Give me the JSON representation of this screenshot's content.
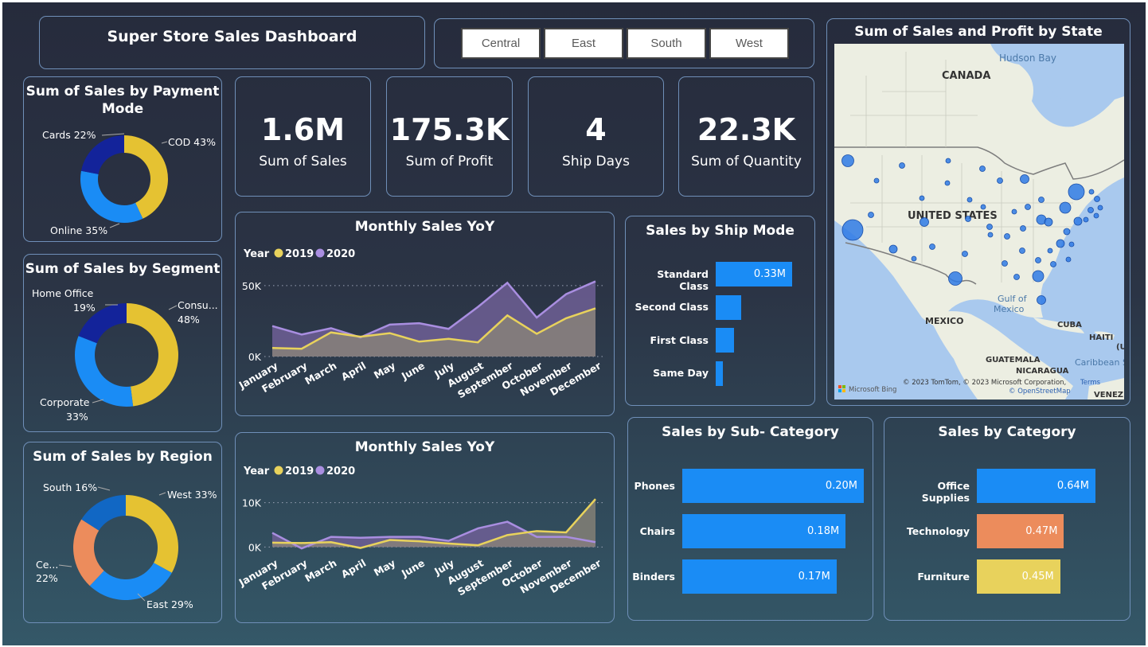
{
  "header": {
    "title": "Super Store Sales Dashboard"
  },
  "slicer": {
    "options": [
      "Central",
      "East",
      "South",
      "West"
    ]
  },
  "kpis": [
    {
      "value": "1.6M",
      "label": "Sum of Sales"
    },
    {
      "value": "175.3K",
      "label": "Sum of Profit"
    },
    {
      "value": "4",
      "label": "Ship Days"
    },
    {
      "value": "22.3K",
      "label": "Sum of Quantity"
    }
  ],
  "payment": {
    "title_l1": "Sum of Sales by Payment",
    "title_l2": "Mode",
    "slices": [
      {
        "name": "COD",
        "pct": 43,
        "label": "COD 43%",
        "color": "#e5c232"
      },
      {
        "name": "Online",
        "pct": 35,
        "label": "Online 35%",
        "color": "#1a8cf5"
      },
      {
        "name": "Cards",
        "pct": 22,
        "label": "Cards 22%",
        "color": "#13239a"
      }
    ]
  },
  "segment": {
    "title": "Sum of Sales by Segment",
    "slices": [
      {
        "name": "Consumer",
        "pct": 48,
        "label1": "Consu...",
        "label2": "48%",
        "color": "#e5c232"
      },
      {
        "name": "Corporate",
        "pct": 33,
        "label1": "Corporate",
        "label2": "33%",
        "color": "#1a8cf5"
      },
      {
        "name": "Home Office",
        "pct": 19,
        "label1": "Home Office",
        "label2": "19%",
        "color": "#13239a"
      }
    ]
  },
  "region": {
    "title": "Sum of Sales by Region",
    "slices": [
      {
        "name": "West",
        "pct": 33,
        "label1": "West 33%",
        "color": "#e5c232"
      },
      {
        "name": "East",
        "pct": 29,
        "label1": "East 29%",
        "color": "#1a8cf5"
      },
      {
        "name": "Central",
        "pct": 22,
        "label1": "Ce...",
        "label2": "22%",
        "color": "#ec8c5c"
      },
      {
        "name": "South",
        "pct": 16,
        "label1": "South 16%",
        "color": "#1167c4"
      }
    ]
  },
  "monthly1": {
    "title": "Monthly Sales YoY",
    "legend_title": "Year",
    "y_ticks": [
      "50K",
      "0K"
    ]
  },
  "monthly2": {
    "title": "Monthly Sales YoY",
    "legend_title": "Year",
    "y_ticks": [
      "10K",
      "0K"
    ]
  },
  "shipmode": {
    "title": "Sales by Ship Mode"
  },
  "subcat": {
    "title": "Sales by Sub- Category"
  },
  "category": {
    "title": "Sales by Category"
  },
  "map": {
    "title": "Sum of Sales and Profit by State",
    "labels": {
      "canada": "CANADA",
      "us": "UNITED STATES",
      "mexico": "MEXICO",
      "hudson": "Hudson Bay",
      "gulf1": "Gulf of",
      "gulf2": "Mexico",
      "cuba": "CUBA",
      "haiti": "HAITI",
      "guatemala": "GUATEMALA",
      "nicaragua": "NICARAGUA",
      "caribbean": "Caribbean Se",
      "venez": "VENEZ",
      "us_short": "(U"
    },
    "copyright": "© 2023 TomTom, © 2023 Microsoft Corporation,",
    "terms": "Terms",
    "osm": "© OpenStreetMap",
    "bing": "Microsoft Bing"
  },
  "chart_data": [
    {
      "type": "area",
      "title": "Monthly Sales YoY",
      "x": [
        "January",
        "February",
        "March",
        "April",
        "May",
        "June",
        "July",
        "August",
        "September",
        "October",
        "November",
        "December"
      ],
      "series": [
        {
          "name": "2019",
          "color": "#e8d25c",
          "values": [
            6000,
            5500,
            17000,
            14000,
            16500,
            10500,
            12500,
            10000,
            29000,
            16000,
            27000,
            34000
          ]
        },
        {
          "name": "2020",
          "color": "#a98ee0",
          "values": [
            21500,
            15500,
            20000,
            13500,
            22500,
            23500,
            19500,
            35000,
            52000,
            27500,
            44000,
            53000
          ]
        }
      ],
      "ylim": [
        0,
        55000
      ],
      "y_ticks": [
        0,
        50000
      ]
    },
    {
      "type": "area",
      "title": "Monthly Sales YoY",
      "x": [
        "January",
        "February",
        "March",
        "April",
        "May",
        "June",
        "July",
        "August",
        "September",
        "October",
        "November",
        "December"
      ],
      "series": [
        {
          "name": "2019",
          "color": "#e8d25c",
          "values": [
            1000,
            900,
            1100,
            -200,
            1600,
            1300,
            800,
            400,
            2700,
            3600,
            3300,
            10800
          ]
        },
        {
          "name": "2020",
          "color": "#a98ee0",
          "values": [
            3200,
            -300,
            2300,
            2100,
            2300,
            2300,
            1400,
            4200,
            5700,
            2300,
            2300,
            1100
          ]
        }
      ],
      "ylim": [
        -1000,
        11000
      ],
      "y_ticks": [
        0,
        10000
      ]
    },
    {
      "type": "bar",
      "title": "Sales by Ship Mode",
      "categories": [
        "Standard Class",
        "Second Class",
        "First Class",
        "Same Day"
      ],
      "values": [
        0.33,
        0.11,
        0.08,
        0.03
      ],
      "data_labels": [
        "0.33M",
        "",
        "",
        ""
      ],
      "color": "#1a8cf5"
    },
    {
      "type": "bar",
      "title": "Sales by Sub- Category",
      "categories": [
        "Phones",
        "Chairs",
        "Binders"
      ],
      "values": [
        0.2,
        0.18,
        0.17
      ],
      "data_labels": [
        "0.20M",
        "0.18M",
        "0.17M"
      ],
      "color": "#1a8cf5"
    },
    {
      "type": "bar",
      "title": "Sales by Category",
      "categories": [
        "Office Supplies",
        "Technology",
        "Furniture"
      ],
      "values": [
        0.64,
        0.47,
        0.45
      ],
      "data_labels": [
        "0.64M",
        "0.47M",
        "0.45M"
      ],
      "colors": [
        "#1a8cf5",
        "#ec8c5c",
        "#e8d25c"
      ]
    }
  ]
}
